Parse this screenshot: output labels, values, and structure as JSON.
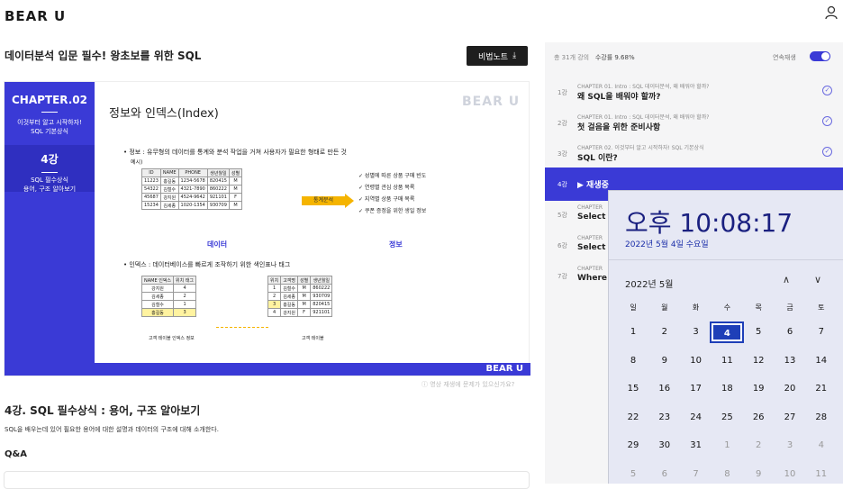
{
  "header": {
    "logo": "BEAR U"
  },
  "main": {
    "course_title": "데이터분석 입문 필수! 왕초보를 위한 SQL",
    "note_button": "비법노트",
    "slide": {
      "chapter": "CHAPTER.02",
      "chapter_sub1": "이것부터 알고 시작하자!",
      "chapter_sub2": "SQL 기본상식",
      "lecture": "4강",
      "lecture_sub1": "SQL 필수상식",
      "lecture_sub2": "용어, 구조 알아보기",
      "heading": "정보와 인덱스(Index)",
      "watermark": "BEAR U",
      "bullet1": "정보 : 유무형의 데이터를 통계와 분석 작업을 거쳐 사용자가 필요한 형태로 만든 것",
      "example": "예시)",
      "table1_headers": [
        "ID",
        "NAME",
        "PHONE",
        "생년월일",
        "성별"
      ],
      "table1_rows": [
        [
          "11223",
          "홍길동",
          "1234-5678",
          "820415",
          "M"
        ],
        [
          "54322",
          "김철수",
          "4321-7890",
          "860222",
          "M"
        ],
        [
          "45687",
          "강지원",
          "4524-9642",
          "921101",
          "F"
        ],
        [
          "15234",
          "김세종",
          "1020-1354",
          "930709",
          "M"
        ]
      ],
      "arrow_label": "통계분석",
      "checks": [
        "성별에 따른 상품 구매 빈도",
        "연령별 관심 상품 목록",
        "지역별 상품 구매 목록",
        "쿠폰 증정을 위한 생일 정보"
      ],
      "caption_data": "데이터",
      "caption_info": "정보",
      "bullet2": "인덱스 : 데이터베이스를 빠르게 조작하기 위한 색인표나 태그",
      "idx_headers": [
        "NAME 인덱스",
        "위치 태그"
      ],
      "idx_rows": [
        [
          "강지원",
          "4"
        ],
        [
          "김세종",
          "2"
        ],
        [
          "김철수",
          "1"
        ],
        [
          "홍길동",
          "3"
        ]
      ],
      "idx_caption": "고객 테이블 인덱스 정보",
      "cust_headers": [
        "위치",
        "고객명",
        "성별",
        "생년월일"
      ],
      "cust_rows": [
        [
          "1",
          "김철수",
          "M",
          "860222"
        ],
        [
          "2",
          "김세종",
          "M",
          "930709"
        ],
        [
          "3",
          "홍길동",
          "M",
          "820415"
        ],
        [
          "4",
          "강지원",
          "F",
          "921101"
        ]
      ],
      "cust_caption": "고객 테이블",
      "footer": "BEAR U"
    },
    "report": "영상 재생에 문제가 있으신가요?",
    "section_title": "4강. SQL 필수상식 : 용어, 구조 알아보기",
    "section_desc": "SQL을 배우는데 있어 필요한 용어에 대한 설명과 데이터의 구조에 대해 소개한다.",
    "qa": "Q&A"
  },
  "sidebar": {
    "total": "총 31개 강의",
    "progress": "수강률 9.68%",
    "continuous": "연속재생",
    "continuous_on": true,
    "items": [
      {
        "num": "1강",
        "t1": "CHAPTER 01. Intro : SQL 데이터분석, 왜 배워야 할까?",
        "t2": "왜 SQL을 배워야 할까?",
        "done": true
      },
      {
        "num": "2강",
        "t1": "CHAPTER 01. Intro : SQL 데이터분석, 왜 배워야 할까?",
        "t2": "첫 걸음을 위한 준비사항",
        "done": true
      },
      {
        "num": "3강",
        "t1": "CHAPTER 02. 이것부터 알고 시작하자! SQL 기본상식",
        "t2": "SQL 이란?",
        "done": true
      },
      {
        "num": "4강",
        "t1": "",
        "t2": "▶ 재생중",
        "active": true
      },
      {
        "num": "5강",
        "t1": "CHAPTER",
        "t2": "Select :"
      },
      {
        "num": "6강",
        "t1": "CHAPTER",
        "t2": "Select :"
      },
      {
        "num": "7강",
        "t1": "CHAPTER",
        "t2": "Where"
      }
    ]
  },
  "calendar": {
    "time": "오후 10:08:17",
    "date": "2022년 5월 4일 수요일",
    "month": "2022년 5월",
    "up": "∧",
    "down": "∨",
    "weekdays": [
      "일",
      "월",
      "화",
      "수",
      "목",
      "금",
      "토"
    ],
    "weeks": [
      [
        "1",
        "2",
        "3",
        "4",
        "5",
        "6",
        "7"
      ],
      [
        "8",
        "9",
        "10",
        "11",
        "12",
        "13",
        "14"
      ],
      [
        "15",
        "16",
        "17",
        "18",
        "19",
        "20",
        "21"
      ],
      [
        "22",
        "23",
        "24",
        "25",
        "26",
        "27",
        "28"
      ],
      [
        "29",
        "30",
        "31",
        "1",
        "2",
        "3",
        "4"
      ],
      [
        "5",
        "6",
        "7",
        "8",
        "9",
        "10",
        "11"
      ]
    ],
    "today": "4"
  }
}
